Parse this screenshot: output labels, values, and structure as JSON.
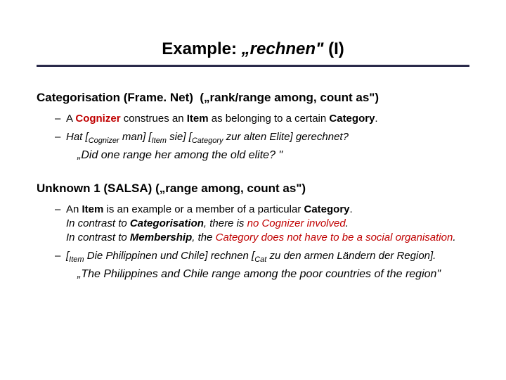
{
  "title_prefix": "Example: ",
  "title_word": "„rechnen\"",
  "title_suffix": " (I)",
  "sec1": {
    "name": "Categorisation (Frame. Net)",
    "gloss": "(„rank/range among, count as\")",
    "b1_a": "A ",
    "b1_cog": "Cognizer",
    "b1_b": " construes an ",
    "b1_item": "Item",
    "b1_c": " as belonging to a certain ",
    "b1_cat": "Category",
    "b1_d": ".",
    "b2_a": "Hat [",
    "b2_cogsub": "Cognizer",
    "b2_b": " man] [",
    "b2_itemsub": "Item",
    "b2_c": " sie] [",
    "b2_catsub": "Category",
    "b2_d": " zur alten Elite] gerechnet?",
    "quote": "„Did one range her among the old elite? \""
  },
  "sec2": {
    "name": "Unknown 1 (SALSA)",
    "gloss": "(„range among, count as\")",
    "b1_a": "An ",
    "b1_item": "Item",
    "b1_b": " is an example or a member of a particular ",
    "b1_cat": "Category",
    "b1_c": ".",
    "b1_l2a": "In contrast to ",
    "b1_l2b": "Categorisation",
    "b1_l2c": ", there is ",
    "b1_l2d": "no Cognizer involved",
    "b1_l2e": ".",
    "b1_l3a": "In contrast to ",
    "b1_l3b": "Membership",
    "b1_l3c": ", the ",
    "b1_l3d": "Category does not have to be a social organisation",
    "b1_l3e": ".",
    "b2_a": "[",
    "b2_itemsub": "Item",
    "b2_b": " Die Philippinen und Chile] rechnen [",
    "b2_catsub": "Cat",
    "b2_c": " zu den armen Ländern der Region].",
    "quote": "„The Philippines and Chile range among the poor countries of the region\""
  }
}
